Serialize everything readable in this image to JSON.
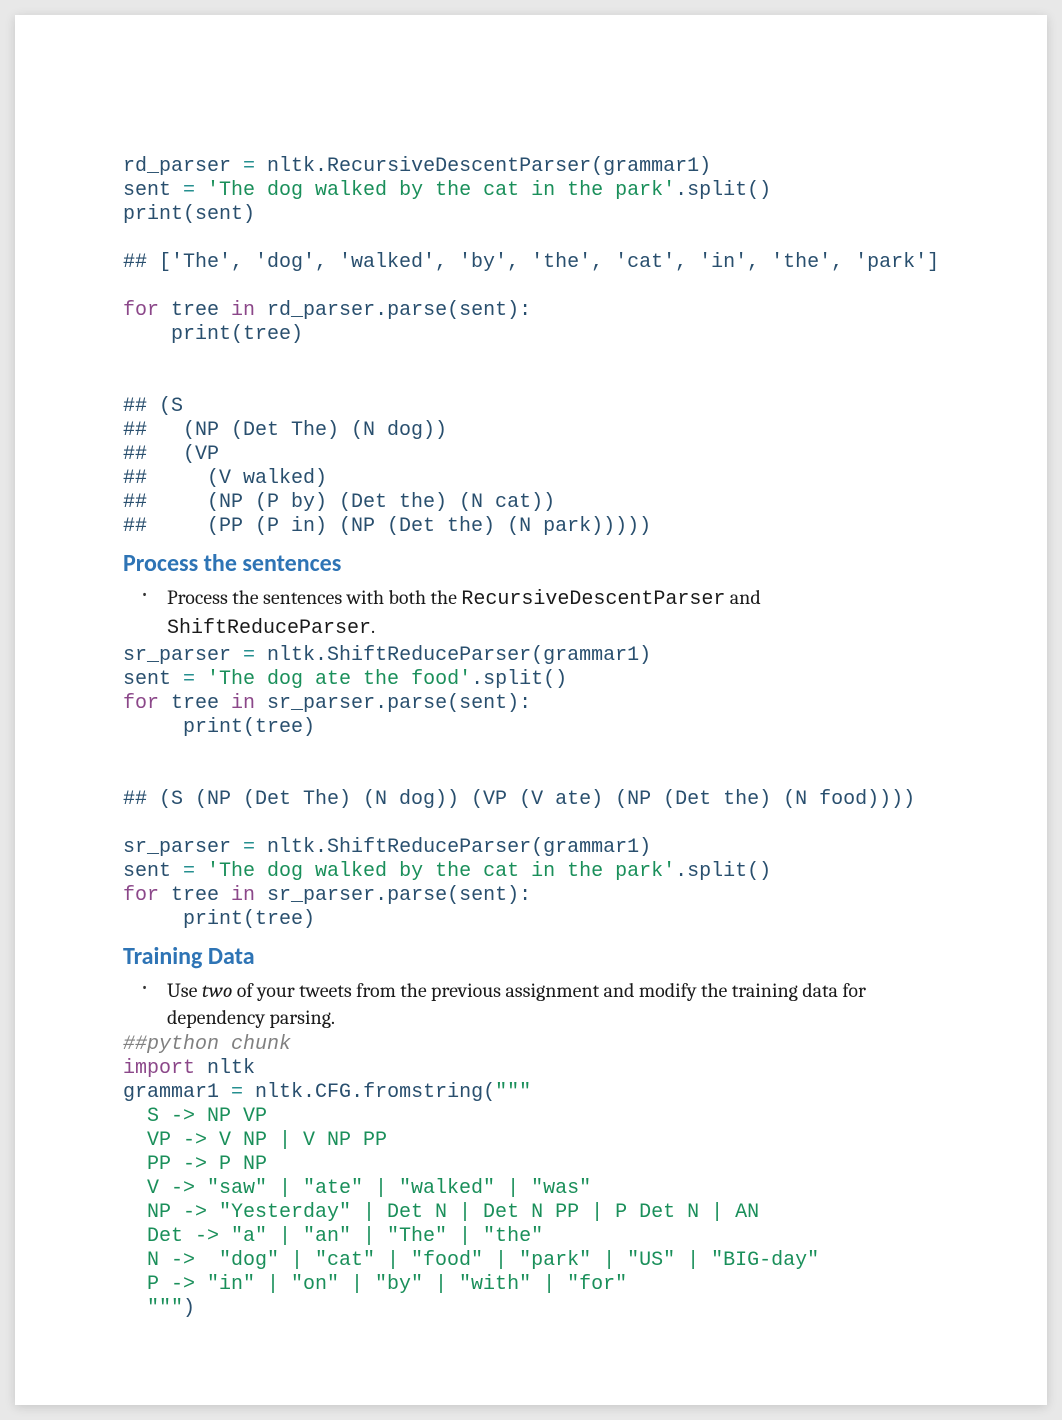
{
  "code_block_1": {
    "l1a": "rd_parser ",
    "l1b": "= ",
    "l1c": "nltk.RecursiveDescentParser(grammar1)",
    "l2a": "sent ",
    "l2b": "= ",
    "l2c": "'The dog walked by the cat in the park'",
    "l2d": ".split()",
    "l3": "print(sent)",
    "l4": "",
    "l5": "## ['The', 'dog', 'walked', 'by', 'the', 'cat', 'in', 'the', 'park']",
    "l6": "",
    "l7a": "for ",
    "l7b": "tree ",
    "l7c": "in ",
    "l7d": "rd_parser.parse(sent):",
    "l8": "    print(tree)",
    "l9": "",
    "l10": "",
    "l11": "## (S",
    "l12": "##   (NP (Det The) (N dog))",
    "l13": "##   (VP",
    "l14": "##     (V walked)",
    "l15": "##     (NP (P by) (Det the) (N cat))",
    "l16": "##     (PP (P in) (NP (Det the) (N park)))))"
  },
  "heading1": "Process the sentences",
  "bullet1a": "Process the sentences with both the ",
  "bullet1b": "RecursiveDescentParser",
  "bullet1c": " and ",
  "bullet1d": "ShiftReduceParser",
  "bullet1e": ".",
  "code_block_2": {
    "l1a": "sr_parser ",
    "l1b": "= ",
    "l1c": "nltk.ShiftReduceParser(grammar1)",
    "l2a": "sent ",
    "l2b": "= ",
    "l2c": "'The dog ate the food'",
    "l2d": ".split()",
    "l3a": "for ",
    "l3b": "tree ",
    "l3c": "in ",
    "l3d": "sr_parser.parse(sent):",
    "l4": "     print(tree)",
    "l5": "",
    "l6": "",
    "l7": "## (S (NP (Det The) (N dog)) (VP (V ate) (NP (Det the) (N food))))",
    "l8": "",
    "l9a": "sr_parser ",
    "l9b": "= ",
    "l9c": "nltk.ShiftReduceParser(grammar1)",
    "l10a": "sent ",
    "l10b": "= ",
    "l10c": "'The dog walked by the cat in the park'",
    "l10d": ".split()",
    "l11a": "for ",
    "l11b": "tree ",
    "l11c": "in ",
    "l11d": "sr_parser.parse(sent):",
    "l12": "     print(tree)"
  },
  "heading2": "Training Data",
  "bullet2a": "Use ",
  "bullet2b": "two",
  "bullet2c": " of your tweets from the previous assignment and modify the training data for dependency parsing.",
  "code_block_3": {
    "l1": "##python chunk",
    "l2a": "import ",
    "l2b": "nltk",
    "l3a": "grammar1 ",
    "l3b": "= ",
    "l3c": "nltk.CFG.fromstring(",
    "l3d": "\"\"\"",
    "l4": "  S -> NP VP",
    "l5": "  VP -> V NP | V NP PP",
    "l6": "  PP -> P NP",
    "l7": "  V -> \"saw\" | \"ate\" | \"walked\" | \"was\"",
    "l8": "  NP -> \"Yesterday\" | Det N | Det N PP | P Det N | AN",
    "l9": "  Det -> \"a\" | \"an\" | \"The\" | \"the\"",
    "l10": "  N ->  \"dog\" | \"cat\" | \"food\" | \"park\" | \"US\" | \"BIG-day\"",
    "l11": "  P -> \"in\" | \"on\" | \"by\" | \"with\" | \"for\"",
    "l12a": "  \"\"\"",
    "l12b": ")"
  }
}
